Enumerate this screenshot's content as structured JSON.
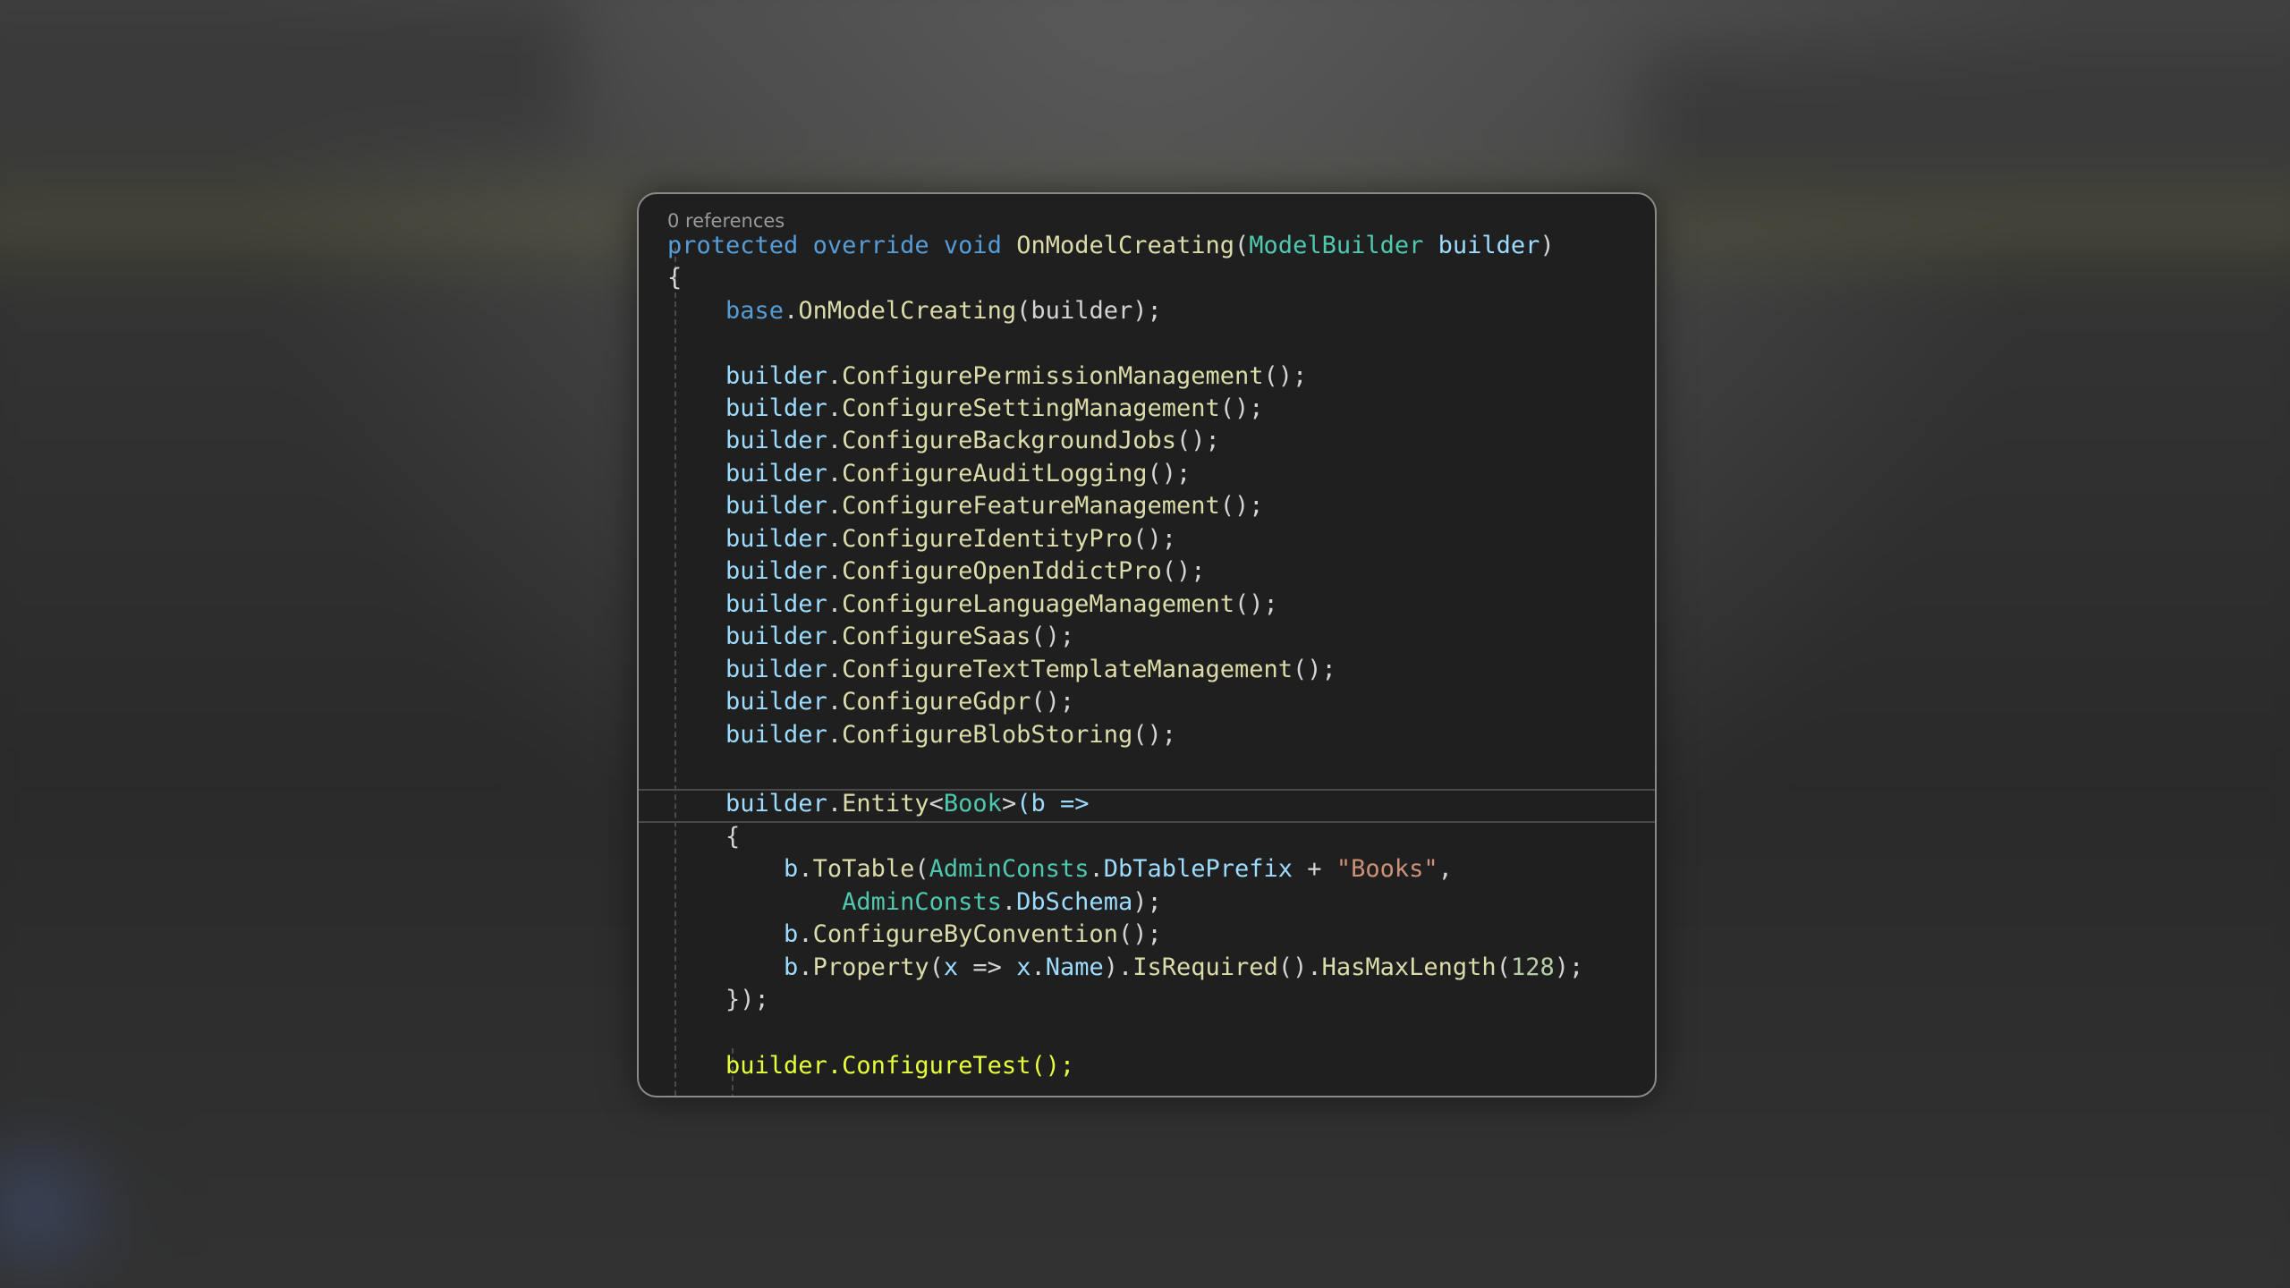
{
  "code_lens": {
    "references": "0 references"
  },
  "code": {
    "sig_protected": "protected",
    "sig_override": "override",
    "sig_void": "void",
    "sig_method": "OnModelCreating",
    "sig_open": "(",
    "sig_type": "ModelBuilder",
    "sig_param": "builder",
    "sig_close": ")",
    "brace_open": "{",
    "base_kw": "base",
    "base_call": "OnModelCreating",
    "base_args": "(builder);",
    "builder": "builder",
    "configure_calls": [
      "ConfigurePermissionManagement",
      "ConfigureSettingManagement",
      "ConfigureBackgroundJobs",
      "ConfigureAuditLogging",
      "ConfigureFeatureManagement",
      "ConfigureIdentityPro",
      "ConfigureOpenIddictPro",
      "ConfigureLanguageManagement",
      "ConfigureSaas",
      "ConfigureTextTemplateManagement",
      "ConfigureGdpr",
      "ConfigureBlobStoring"
    ],
    "call_suffix": "();",
    "entity_method": "Entity",
    "entity_type": "Book",
    "entity_lambda": "(b =>",
    "inner_brace_open": "{",
    "b": "b",
    "to_table": "ToTable",
    "admin_consts": "AdminConsts",
    "db_table_prefix": "DbTablePrefix",
    "plus": " + ",
    "books_str": "\"Books\"",
    "db_schema": "DbSchema",
    "configure_by_convention": "ConfigureByConvention",
    "property": "Property",
    "x": "x",
    "name_prop": "Name",
    "is_required": "IsRequired",
    "has_max_length": "HasMaxLength",
    "max_len": "128",
    "inner_close": "});",
    "configure_test": "ConfigureTest"
  }
}
